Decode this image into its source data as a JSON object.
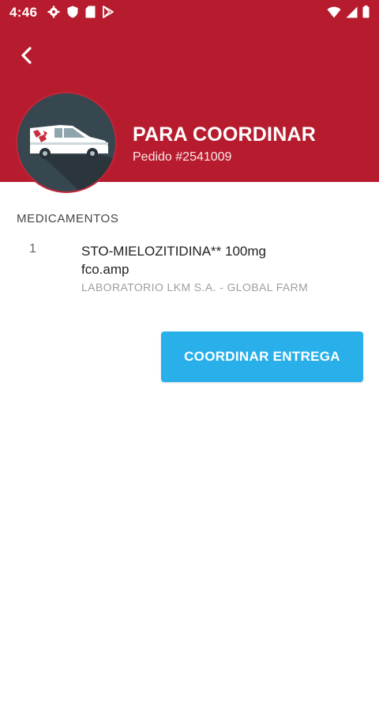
{
  "status_bar": {
    "time": "4:46",
    "left_icons": [
      "gear-icon",
      "shield-icon",
      "sd-card-icon",
      "play-store-icon"
    ],
    "right_icons": [
      "wifi-icon",
      "signal-icon",
      "battery-icon"
    ]
  },
  "header": {
    "title": "PARA COORDINAR",
    "order": "Pedido #2541009",
    "background_color": "#b71c2e"
  },
  "medications": {
    "section_label": "MEDICAMENTOS",
    "items": [
      {
        "quantity": "1",
        "name_line1": "STO-MIELOZITIDINA** 100mg",
        "name_line2": "fco.amp",
        "laboratory": "LABORATORIO  LKM S.A. - GLOBAL FARM"
      }
    ]
  },
  "actions": {
    "coordinate_label": "COORDINAR ENTREGA",
    "button_color": "#29b0ea"
  }
}
